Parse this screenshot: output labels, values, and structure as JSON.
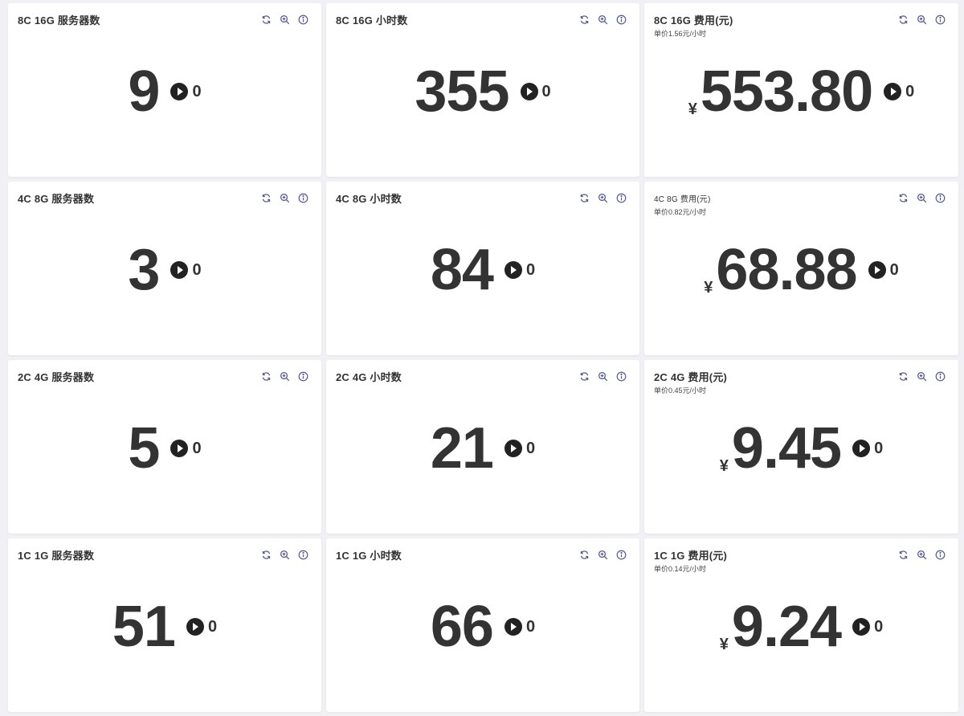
{
  "cards": [
    {
      "title": "8C 16G 服务器数",
      "subtitle": "",
      "currency": "",
      "value": "9",
      "delta": "0"
    },
    {
      "title": "8C 16G 小时数",
      "subtitle": "",
      "currency": "",
      "value": "355",
      "delta": "0"
    },
    {
      "title": "8C 16G 费用(元)",
      "subtitle": "单价1.56元/小时",
      "currency": "¥",
      "value": "553.80",
      "delta": "0"
    },
    {
      "title": "4C 8G 服务器数",
      "subtitle": "",
      "currency": "",
      "value": "3",
      "delta": "0"
    },
    {
      "title": "4C 8G 小时数",
      "subtitle": "",
      "currency": "",
      "value": "84",
      "delta": "0"
    },
    {
      "title": "4C 8G 费用(元)",
      "subtitle": "单价0.82元/小时",
      "currency": "¥",
      "value": "68.88",
      "delta": "0"
    },
    {
      "title": "2C 4G 服务器数",
      "subtitle": "",
      "currency": "",
      "value": "5",
      "delta": "0"
    },
    {
      "title": "2C 4G 小时数",
      "subtitle": "",
      "currency": "",
      "value": "21",
      "delta": "0"
    },
    {
      "title": "2C 4G 费用(元)",
      "subtitle": "单价0.45元/小时",
      "currency": "¥",
      "value": "9.45",
      "delta": "0"
    },
    {
      "title": "1C 1G 服务器数",
      "subtitle": "",
      "currency": "",
      "value": "51",
      "delta": "0"
    },
    {
      "title": "1C 1G 小时数",
      "subtitle": "",
      "currency": "",
      "value": "66",
      "delta": "0"
    },
    {
      "title": "1C 1G 费用(元)",
      "subtitle": "单价0.14元/小时",
      "currency": "¥",
      "value": "9.24",
      "delta": "0"
    }
  ],
  "icons": [
    "refresh-icon",
    "zoom-in-icon",
    "info-icon"
  ],
  "colors": {
    "icon": "#565a99",
    "text": "#333333",
    "background": "#f1f1f5"
  }
}
